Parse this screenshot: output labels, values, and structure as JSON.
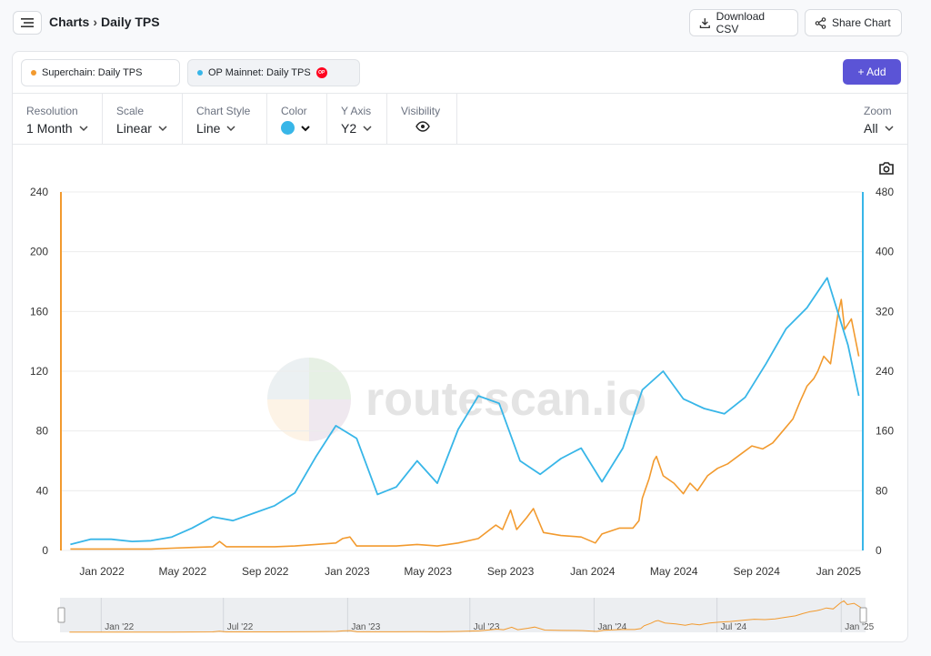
{
  "breadcrumb": {
    "root": "Charts",
    "separator": "›",
    "current": "Daily TPS"
  },
  "toolbar": {
    "download_label": "Download CSV",
    "share_label": "Share Chart"
  },
  "series_chips": [
    {
      "label": "Superchain: Daily TPS",
      "color": "#f29a2e"
    },
    {
      "label": "OP Mainnet: Daily TPS",
      "color": "#38b6e8",
      "badge": "OP"
    }
  ],
  "add_label": "+ Add",
  "controls": {
    "resolution": {
      "label": "Resolution",
      "value": "1 Month"
    },
    "scale": {
      "label": "Scale",
      "value": "Linear"
    },
    "style": {
      "label": "Chart Style",
      "value": "Line"
    },
    "color": {
      "label": "Color",
      "value": "#38b6e8"
    },
    "yaxis": {
      "label": "Y Axis",
      "value": "Y2"
    },
    "visibility": {
      "label": "Visibility"
    },
    "zoom": {
      "label": "Zoom",
      "value": "All"
    }
  },
  "watermark": "routescan.io",
  "chart_data": {
    "type": "line",
    "x_ticks": [
      "Jan 2022",
      "May 2022",
      "Sep 2022",
      "Jan 2023",
      "May 2023",
      "Sep 2023",
      "Jan 2024",
      "May 2024",
      "Sep 2024",
      "Jan 2025"
    ],
    "y1_ticks": [
      0,
      40,
      80,
      120,
      160,
      200,
      240
    ],
    "y2_ticks": [
      0,
      80,
      160,
      240,
      320,
      400,
      480
    ],
    "y1lim": [
      0,
      240
    ],
    "y2lim": [
      0,
      480
    ],
    "grid": true,
    "series": [
      {
        "name": "Superchain: Daily TPS",
        "axis": "y1",
        "color": "#f29a2e",
        "points": [
          [
            "2021-11-15",
            1
          ],
          [
            "2021-12-15",
            1
          ],
          [
            "2022-01-15",
            1
          ],
          [
            "2022-02-15",
            1
          ],
          [
            "2022-03-15",
            1
          ],
          [
            "2022-04-15",
            1.5
          ],
          [
            "2022-05-15",
            2
          ],
          [
            "2022-06-15",
            2.5
          ],
          [
            "2022-06-25",
            6
          ],
          [
            "2022-07-05",
            2.5
          ],
          [
            "2022-08-15",
            2.5
          ],
          [
            "2022-09-15",
            2.5
          ],
          [
            "2022-10-15",
            3
          ],
          [
            "2022-11-15",
            4
          ],
          [
            "2022-12-15",
            5
          ],
          [
            "2022-12-25",
            8
          ],
          [
            "2023-01-05",
            9
          ],
          [
            "2023-01-15",
            3
          ],
          [
            "2023-02-15",
            3
          ],
          [
            "2023-03-15",
            3
          ],
          [
            "2023-04-15",
            4
          ],
          [
            "2023-05-15",
            3
          ],
          [
            "2023-06-15",
            5
          ],
          [
            "2023-07-15",
            8
          ],
          [
            "2023-08-10",
            17
          ],
          [
            "2023-08-20",
            14
          ],
          [
            "2023-09-01",
            27
          ],
          [
            "2023-09-10",
            14
          ],
          [
            "2023-09-25",
            22
          ],
          [
            "2023-10-05",
            28
          ],
          [
            "2023-10-20",
            12
          ],
          [
            "2023-11-15",
            10
          ],
          [
            "2023-12-15",
            9
          ],
          [
            "2024-01-05",
            5
          ],
          [
            "2024-01-15",
            11
          ],
          [
            "2024-02-10",
            15
          ],
          [
            "2024-03-01",
            15
          ],
          [
            "2024-03-10",
            20
          ],
          [
            "2024-03-15",
            35
          ],
          [
            "2024-03-25",
            48
          ],
          [
            "2024-04-01",
            60
          ],
          [
            "2024-04-05",
            63
          ],
          [
            "2024-04-15",
            50
          ],
          [
            "2024-05-01",
            45
          ],
          [
            "2024-05-15",
            38
          ],
          [
            "2024-05-25",
            45
          ],
          [
            "2024-06-05",
            40
          ],
          [
            "2024-06-20",
            50
          ],
          [
            "2024-07-05",
            55
          ],
          [
            "2024-07-20",
            58
          ],
          [
            "2024-08-10",
            65
          ],
          [
            "2024-08-25",
            70
          ],
          [
            "2024-09-10",
            68
          ],
          [
            "2024-09-25",
            72
          ],
          [
            "2024-10-10",
            80
          ],
          [
            "2024-10-25",
            88
          ],
          [
            "2024-11-05",
            100
          ],
          [
            "2024-11-15",
            110
          ],
          [
            "2024-11-25",
            115
          ],
          [
            "2024-12-01",
            120
          ],
          [
            "2024-12-10",
            130
          ],
          [
            "2024-12-20",
            125
          ],
          [
            "2024-12-31",
            158
          ],
          [
            "2025-01-05",
            168
          ],
          [
            "2025-01-10",
            148
          ],
          [
            "2025-01-20",
            155
          ],
          [
            "2025-01-31",
            130
          ]
        ]
      },
      {
        "name": "OP Mainnet: Daily TPS",
        "axis": "y2",
        "color": "#38b6e8",
        "points": [
          [
            "2021-11-15",
            8
          ],
          [
            "2021-12-15",
            15
          ],
          [
            "2022-01-15",
            15
          ],
          [
            "2022-02-15",
            12
          ],
          [
            "2022-03-15",
            13
          ],
          [
            "2022-04-15",
            18
          ],
          [
            "2022-05-15",
            30
          ],
          [
            "2022-06-15",
            45
          ],
          [
            "2022-07-15",
            40
          ],
          [
            "2022-08-15",
            50
          ],
          [
            "2022-09-15",
            60
          ],
          [
            "2022-10-15",
            77
          ],
          [
            "2022-11-15",
            125
          ],
          [
            "2022-12-15",
            167
          ],
          [
            "2023-01-15",
            150
          ],
          [
            "2023-02-15",
            75
          ],
          [
            "2023-03-15",
            85
          ],
          [
            "2023-04-15",
            120
          ],
          [
            "2023-05-15",
            90
          ],
          [
            "2023-06-15",
            162
          ],
          [
            "2023-07-15",
            207
          ],
          [
            "2023-08-15",
            197
          ],
          [
            "2023-09-15",
            120
          ],
          [
            "2023-10-15",
            102
          ],
          [
            "2023-11-15",
            123
          ],
          [
            "2023-12-15",
            137
          ],
          [
            "2024-01-15",
            92
          ],
          [
            "2024-02-15",
            137
          ],
          [
            "2024-03-15",
            215
          ],
          [
            "2024-04-15",
            240
          ],
          [
            "2024-05-15",
            203
          ],
          [
            "2024-06-15",
            190
          ],
          [
            "2024-07-15",
            183
          ],
          [
            "2024-08-15",
            205
          ],
          [
            "2024-09-15",
            250
          ],
          [
            "2024-10-15",
            297
          ],
          [
            "2024-11-15",
            325
          ],
          [
            "2024-12-15",
            365
          ],
          [
            "2025-01-15",
            275
          ],
          [
            "2025-01-31",
            207
          ]
        ]
      }
    ],
    "navigator": {
      "ticks": [
        "Jan '22",
        "Jul '22",
        "Jan '23",
        "Jul '23",
        "Jan '24",
        "Jul '24",
        "Jan '25"
      ]
    }
  }
}
